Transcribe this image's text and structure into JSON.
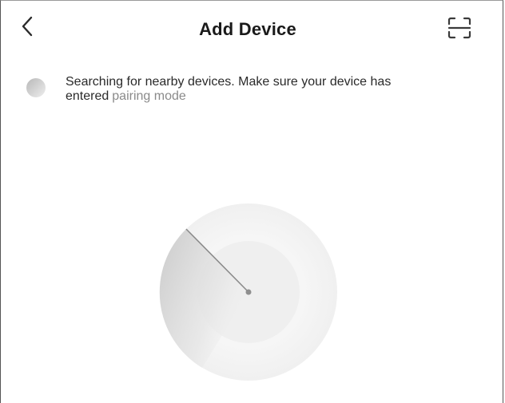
{
  "header": {
    "title": "Add Device",
    "back_icon": "chevron-left-icon",
    "scan_icon": "scan-icon"
  },
  "status": {
    "message": "Searching for nearby devices. Make sure your device has entered",
    "link_label": "pairing mode",
    "spinner_icon": "loading-spinner-icon"
  },
  "radar": {
    "icon": "radar-scan-icon"
  },
  "colors": {
    "text_primary": "#1a1a1a",
    "text_secondary": "#8a8a8a",
    "radar_outer": "#f4f4f4",
    "radar_inner": "#ececec",
    "radar_sweep": "#d4d4d4"
  }
}
